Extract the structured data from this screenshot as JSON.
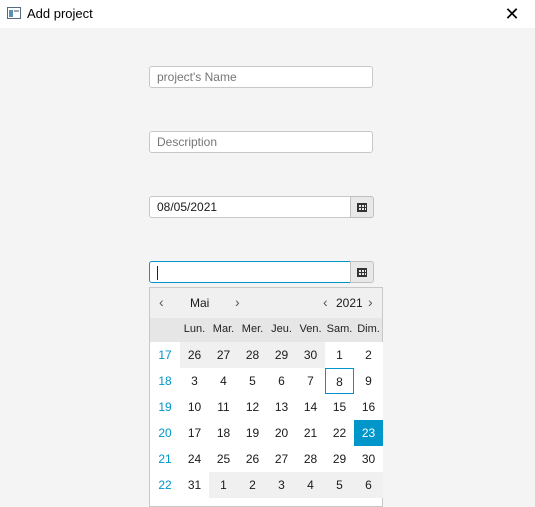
{
  "window": {
    "title": "Add project",
    "close_label": "✕"
  },
  "form": {
    "name_placeholder": "project's Name",
    "description_placeholder": "Description",
    "start_date_value": "08/05/2021",
    "end_date_value": ""
  },
  "calendar": {
    "month": "Mai",
    "year": "2021",
    "prev_month": "‹",
    "next_month": "›",
    "prev_year": "‹",
    "next_year": "›",
    "weekdays": [
      "Lun.",
      "Mar.",
      "Mer.",
      "Jeu.",
      "Ven.",
      "Sam.",
      "Dim."
    ],
    "weeks": [
      {
        "num": "17",
        "days": [
          "26",
          "27",
          "28",
          "29",
          "30",
          "1",
          "2"
        ]
      },
      {
        "num": "18",
        "days": [
          "3",
          "4",
          "5",
          "6",
          "7",
          "8",
          "9"
        ]
      },
      {
        "num": "19",
        "days": [
          "10",
          "11",
          "12",
          "13",
          "14",
          "15",
          "16"
        ]
      },
      {
        "num": "20",
        "days": [
          "17",
          "18",
          "19",
          "20",
          "21",
          "22",
          "23"
        ]
      },
      {
        "num": "21",
        "days": [
          "24",
          "25",
          "26",
          "27",
          "28",
          "29",
          "30"
        ]
      },
      {
        "num": "22",
        "days": [
          "31",
          "1",
          "2",
          "3",
          "4",
          "5",
          "6"
        ]
      }
    ],
    "today": "8",
    "selected": "23",
    "colors": {
      "accent": "#0096c9",
      "other_month_bg": "#f0f0f0",
      "current_month_bg": "#ffffff"
    }
  }
}
